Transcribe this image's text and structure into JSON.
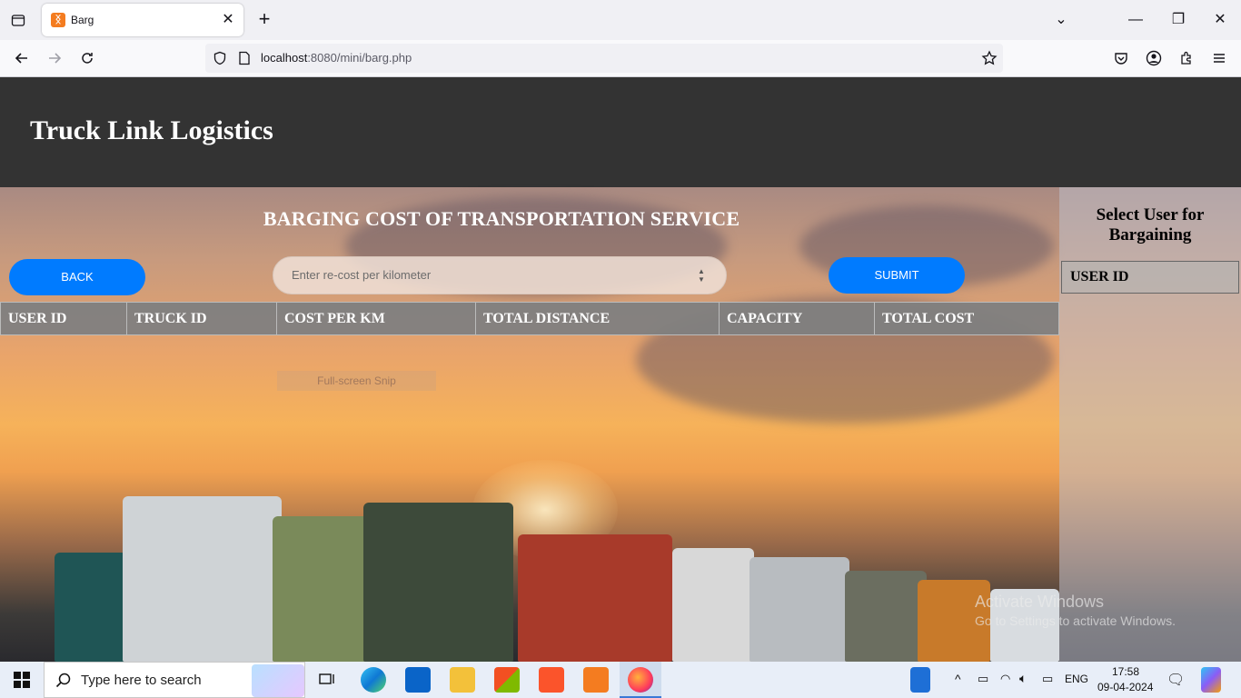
{
  "browser": {
    "tab_title": "Barg",
    "url_host": "localhost",
    "url_rest": ":8080/mini/barg.php"
  },
  "site": {
    "title": "Truck Link Logistics"
  },
  "main": {
    "heading": "BARGING COST OF TRANSPORTATION SERVICE",
    "back_label": "BACK",
    "cost_placeholder": "Enter re-cost per kilometer",
    "submit_label": "SUBMIT",
    "table_headers": [
      "USER ID",
      "TRUCK ID",
      "COST PER KM",
      "TOTAL DISTANCE",
      "CAPACITY",
      "TOTAL COST"
    ]
  },
  "side_panel": {
    "title": "Select User for Bargaining",
    "header": "USER ID"
  },
  "overlay": {
    "snip_label": "Full-screen Snip",
    "activate_title": "Activate Windows",
    "activate_sub": "Go to Settings to activate Windows."
  },
  "taskbar": {
    "search_placeholder": "Type here to search",
    "language": "ENG",
    "time": "17:58",
    "date": "09-04-2024"
  }
}
